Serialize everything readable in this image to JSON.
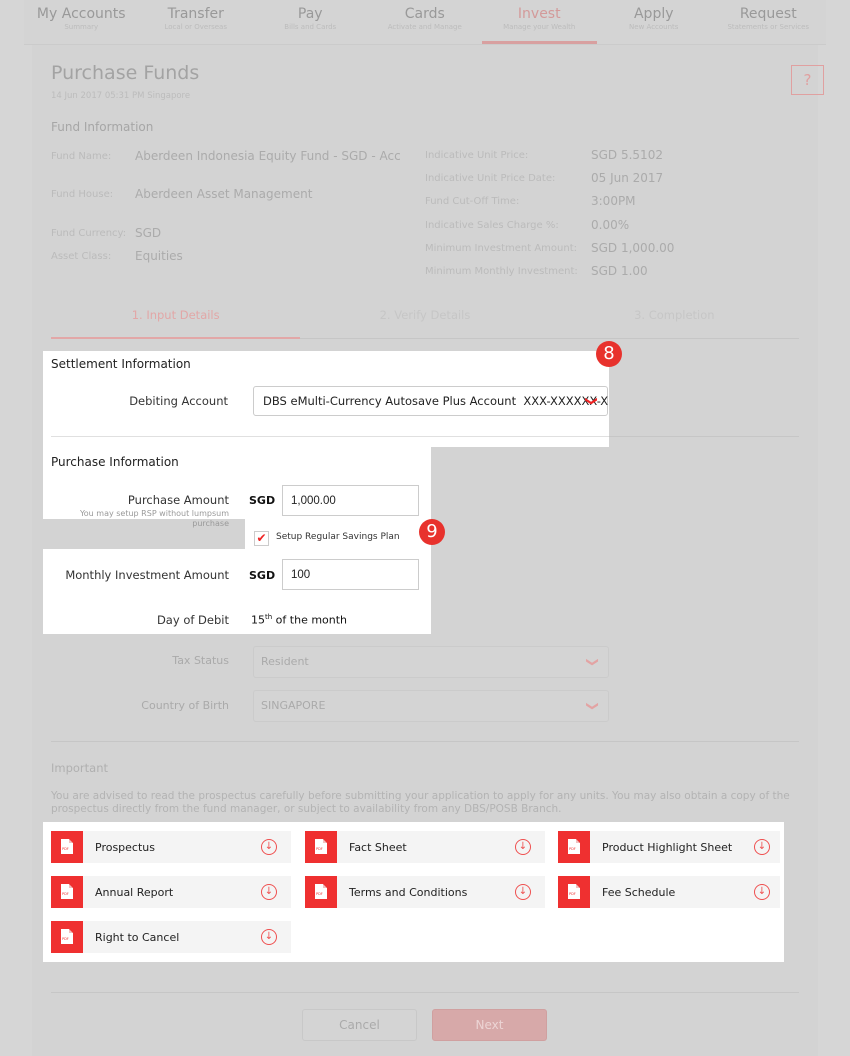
{
  "nav": [
    {
      "title": "My Accounts",
      "sub": "Summary"
    },
    {
      "title": "Transfer",
      "sub": "Local or Overseas"
    },
    {
      "title": "Pay",
      "sub": "Bills and Cards"
    },
    {
      "title": "Cards",
      "sub": "Activate and Manage"
    },
    {
      "title": "Invest",
      "sub": "Manage your Wealth"
    },
    {
      "title": "Apply",
      "sub": "New Accounts"
    },
    {
      "title": "Request",
      "sub": "Statements or Services"
    }
  ],
  "page": {
    "title": "Purchase Funds",
    "timestamp": "14 Jun 2017 05:31 PM Singapore",
    "help_icon": "?"
  },
  "fund_info": {
    "heading": "Fund Information",
    "left": [
      {
        "label": "Fund Name:",
        "value": "Aberdeen Indonesia Equity Fund - SGD - Acc"
      },
      {
        "label": "Fund House:",
        "value": "Aberdeen Asset Management"
      },
      {
        "label": "Fund Currency:",
        "value": "SGD"
      },
      {
        "label": "Asset Class:",
        "value": "Equities"
      }
    ],
    "right": [
      {
        "label": "Indicative Unit Price:",
        "value": "SGD 5.5102"
      },
      {
        "label": "Indicative Unit Price Date:",
        "value": "05 Jun 2017"
      },
      {
        "label": "Fund Cut-Off Time:",
        "value": "3:00PM"
      },
      {
        "label": "Indicative Sales Charge %:",
        "value": "0.00%"
      },
      {
        "label": "Minimum Investment Amount:",
        "value": "SGD 1,000.00"
      },
      {
        "label": "Minimum Monthly Investment:",
        "value": "SGD 1.00"
      }
    ]
  },
  "steps": [
    "1. Input Details",
    "2. Verify Details",
    "3. Completion"
  ],
  "settlement": {
    "heading": "Settlement Information",
    "debiting_label": "Debiting Account",
    "debiting_value": "DBS eMulti-Currency Autosave Plus Account  XXX-XXXXXX-X",
    "badge": "8"
  },
  "purchase": {
    "heading": "Purchase Information",
    "amount_label": "Purchase Amount",
    "amount_hint": "You may setup RSP without lumpsum purchase",
    "currency": "SGD",
    "amount_value": "1,000.00",
    "rsp_label": "Setup Regular Savings Plan",
    "rsp_checked": true,
    "badge": "9",
    "monthly_label": "Monthly Investment Amount",
    "monthly_value": "100",
    "day_label": "Day of Debit",
    "day_num": "15",
    "day_sup": "th",
    "day_rest": " of the month"
  },
  "tax": {
    "tax_label": "Tax Status",
    "tax_value": "Resident",
    "birth_label": "Country of Birth",
    "birth_value": "SINGAPORE"
  },
  "important": {
    "heading": "Important",
    "text": "You are advised to read the prospectus carefully before submitting your application to apply for any units. You may also obtain a copy of the prospectus directly from the fund manager, or subject to availability from any DBS/POSB Branch."
  },
  "documents": [
    {
      "label": "Prospectus"
    },
    {
      "label": "Fact Sheet"
    },
    {
      "label": "Product Highlight Sheet"
    },
    {
      "label": "Annual Report"
    },
    {
      "label": "Terms and Conditions"
    },
    {
      "label": "Fee Schedule"
    },
    {
      "label": "Right to Cancel"
    }
  ],
  "pdf_text": "PDF",
  "download_glyph": "↓",
  "chevron_glyph": "❯",
  "check_glyph": "✔",
  "buttons": {
    "cancel": "Cancel",
    "next": "Next"
  },
  "colors": {
    "accent": "#e8322d",
    "pdf_red": "#ef3030"
  }
}
